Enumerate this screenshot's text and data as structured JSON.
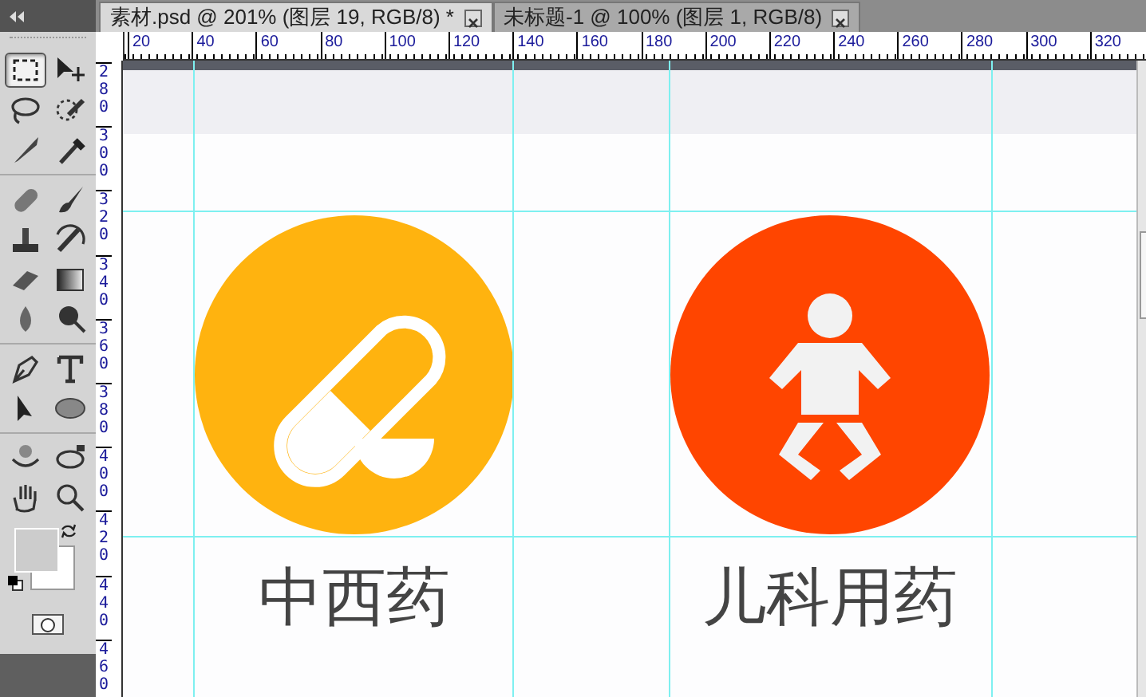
{
  "tabs": [
    {
      "label": "素材.psd @ 201% (图层 19, RGB/8) *",
      "selected": true
    },
    {
      "label": "未标题-1 @ 100% (图层 1, RGB/8)",
      "selected": false
    }
  ],
  "tool_groups": [
    [
      {
        "kind": "marquee",
        "selected": true
      },
      {
        "kind": "move",
        "selected": false
      },
      {
        "kind": "lasso",
        "selected": false
      },
      {
        "kind": "quick-select",
        "selected": false
      },
      {
        "kind": "crop",
        "selected": false
      },
      {
        "kind": "eyedropper",
        "selected": false
      }
    ],
    [
      {
        "kind": "heal",
        "selected": false
      },
      {
        "kind": "brush",
        "selected": false
      },
      {
        "kind": "stamp",
        "selected": false
      },
      {
        "kind": "history-brush",
        "selected": false
      },
      {
        "kind": "eraser",
        "selected": false
      },
      {
        "kind": "gradient",
        "selected": false
      },
      {
        "kind": "blur",
        "selected": false
      },
      {
        "kind": "dodge",
        "selected": false
      }
    ],
    [
      {
        "kind": "pen",
        "selected": false
      },
      {
        "kind": "type",
        "selected": false
      },
      {
        "kind": "path-select",
        "selected": false
      },
      {
        "kind": "shape",
        "selected": false
      }
    ],
    [
      {
        "kind": "rotate-3d",
        "selected": false
      },
      {
        "kind": "orbit-3d",
        "selected": false
      },
      {
        "kind": "hand",
        "selected": false
      },
      {
        "kind": "zoom",
        "selected": false
      }
    ]
  ],
  "ruler": {
    "horizontal": [
      "20",
      "40",
      "60",
      "80",
      "100",
      "120",
      "140",
      "160",
      "180",
      "200",
      "220",
      "240",
      "260",
      "280",
      "300",
      "320"
    ],
    "vertical": [
      "280",
      "300",
      "320",
      "340",
      "360",
      "380",
      "400",
      "420",
      "440",
      "460"
    ]
  },
  "categories": [
    {
      "label": "中西药",
      "color": "#ffb30f",
      "kind": "pill"
    },
    {
      "label": "儿科用药",
      "color": "#ff4500",
      "kind": "baby"
    }
  ]
}
